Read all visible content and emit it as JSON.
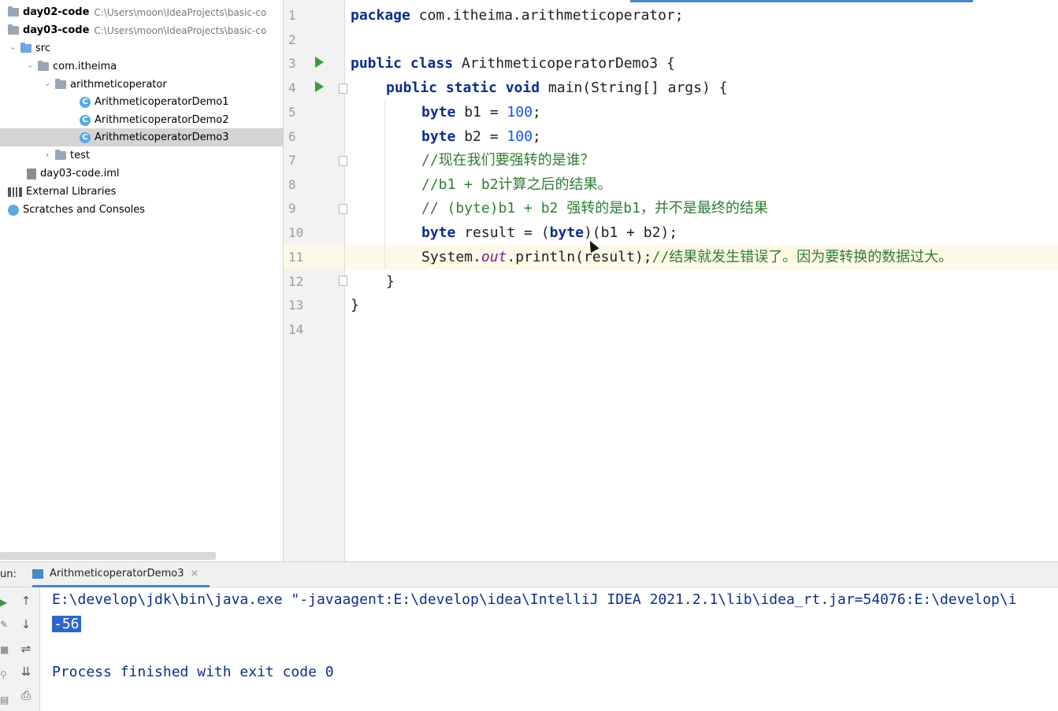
{
  "project_tree": [
    {
      "label": "day02-code",
      "path": "C:\\Users\\moon\\IdeaProjects\\basic-co",
      "type": "module"
    },
    {
      "label": "day03-code",
      "path": "C:\\Users\\moon\\IdeaProjects\\basic-co",
      "type": "module"
    },
    {
      "label": "src",
      "type": "source-folder"
    },
    {
      "label": "com.itheima",
      "type": "package"
    },
    {
      "label": "arithmeticoperator",
      "type": "package"
    },
    {
      "label": "ArithmeticoperatorDemo1",
      "type": "class"
    },
    {
      "label": "ArithmeticoperatorDemo2",
      "type": "class"
    },
    {
      "label": "ArithmeticoperatorDemo3",
      "type": "class",
      "selected": true
    },
    {
      "label": "test",
      "type": "folder"
    },
    {
      "label": "day03-code.iml",
      "type": "file"
    },
    {
      "label": "External Libraries",
      "type": "libraries"
    },
    {
      "label": "Scratches and Consoles",
      "type": "scratches"
    }
  ],
  "editor": {
    "line_numbers": [
      "1",
      "2",
      "3",
      "4",
      "5",
      "6",
      "7",
      "8",
      "9",
      "10",
      "11",
      "12",
      "13",
      "14"
    ],
    "current_line": 11,
    "code": {
      "l1_kw": "package",
      "l1_rest": " com.itheima.arithmeticoperator;",
      "l3_kw": "public class",
      "l3_rest": " ArithmeticoperatorDemo3 {",
      "l4_kw": "public static void",
      "l4_rest": " main(String[] args) {",
      "l5_kw": "byte",
      "l5_mid": " b1 = ",
      "l5_num": "100",
      "l5_end": ";",
      "l6_kw": "byte",
      "l6_mid": " b2 = ",
      "l6_num": "100",
      "l6_end": ";",
      "l7_cmt": "//现在我们要强转的是谁？",
      "l8_cmt": "//b1 + b2计算之后的结果。",
      "l9_cmt": "// (byte)b1 + b2 强转的是b1，并不是最终的结果",
      "l10_kw": "byte",
      "l10_mid": " result = (",
      "l10_kw2": "byte",
      "l10_end": ")(b1 + b2);",
      "l11_a": "System.",
      "l11_field": "out",
      "l11_b": ".println(result);",
      "l11_cmt": "//结果就发生错误了。因为要转换的数据过大。",
      "l12": "}",
      "l13": "}"
    }
  },
  "run_panel": {
    "label": "un:",
    "tab_label": "ArithmeticoperatorDemo3",
    "tab_close": "×",
    "console_lines": {
      "command": "E:\\develop\\jdk\\bin\\java.exe \"-javaagent:E:\\develop\\idea\\IntelliJ IDEA 2021.2.1\\lib\\idea_rt.jar=54076:E:\\develop\\i",
      "output": "-56",
      "finished": "Process finished with exit code 0"
    }
  }
}
